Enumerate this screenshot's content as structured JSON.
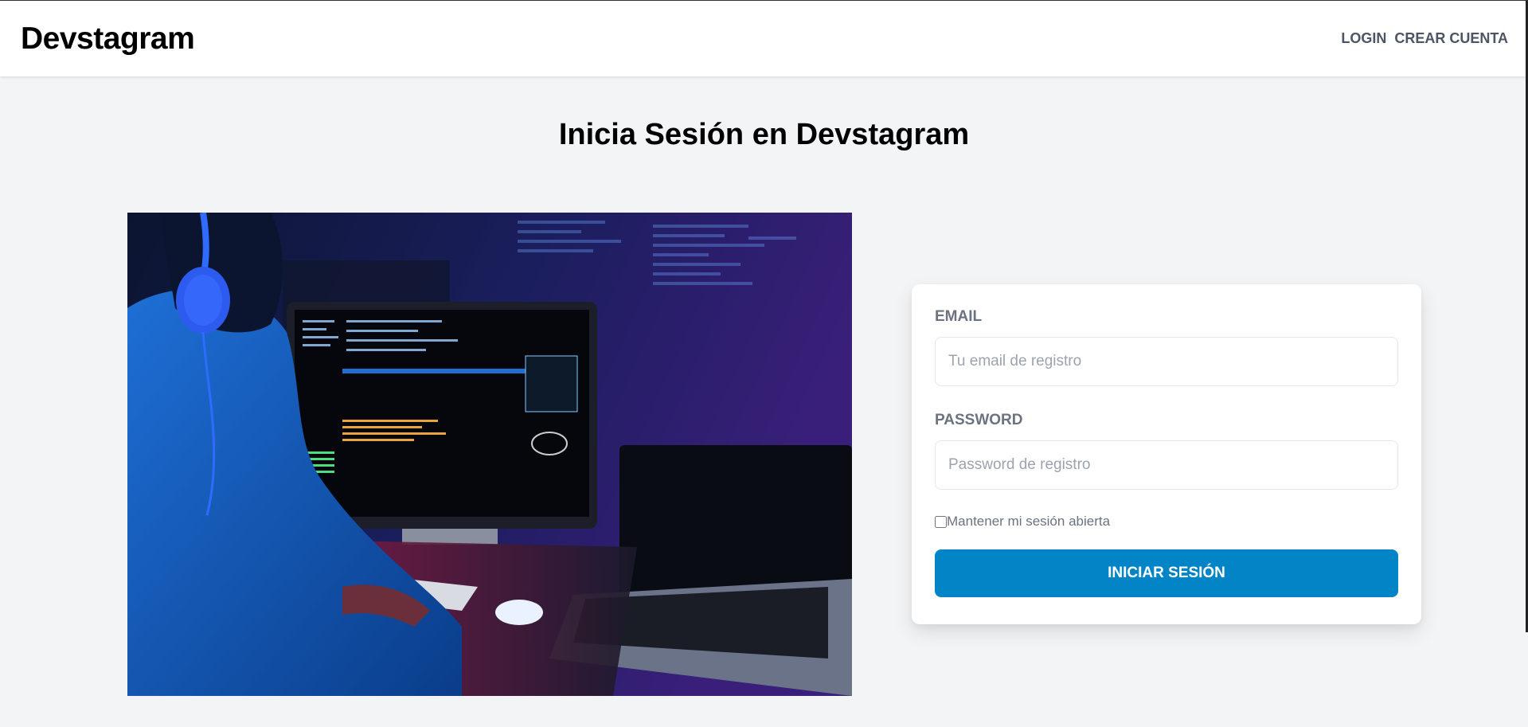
{
  "header": {
    "brand": "Devstagram",
    "nav": {
      "login": "Login",
      "register": "Crear Cuenta"
    }
  },
  "page": {
    "title": "Inicia Sesión en Devstagram"
  },
  "hero_image": {
    "icon": "developer-photo"
  },
  "form": {
    "email_label": "Email",
    "email_placeholder": "Tu email de registro",
    "email_value": "",
    "password_label": "Password",
    "password_placeholder": "Password de registro",
    "password_value": "",
    "remember_label": "Mantener mi sesión abierta",
    "remember_checked": false,
    "submit_label": "Iniciar Sesión"
  },
  "colors": {
    "accent": "#0284c7",
    "background": "#f3f4f6"
  }
}
